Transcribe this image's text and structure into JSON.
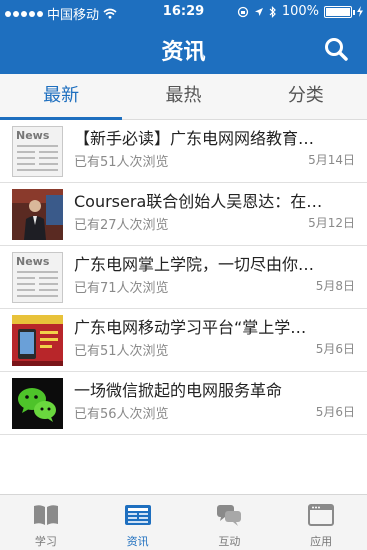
{
  "status_bar": {
    "carrier": "中国移动",
    "time": "16:29",
    "battery": "100%",
    "battery_level": 1.0
  },
  "nav": {
    "title": "资讯",
    "search_icon": "search-icon"
  },
  "tabs": [
    {
      "label": "最新",
      "active": true
    },
    {
      "label": "最热",
      "active": false
    },
    {
      "label": "分类",
      "active": false
    }
  ],
  "news": [
    {
      "title": "【新手必读】广东电网网络教育…",
      "views": "已有51人次浏览",
      "date": "5月14日",
      "thumb": "news-paper"
    },
    {
      "title": "Coursera联合创始人吴恩达：在…",
      "views": "已有27人次浏览",
      "date": "5月12日",
      "thumb": "speaker-photo"
    },
    {
      "title": "广东电网掌上学院，一切尽由你…",
      "views": "已有71人次浏览",
      "date": "5月8日",
      "thumb": "news-paper"
    },
    {
      "title": "广东电网移动学习平台“掌上学…",
      "views": "已有51人次浏览",
      "date": "5月6日",
      "thumb": "platform-banner"
    },
    {
      "title": "一场微信掀起的电网服务革命",
      "views": "已有56人次浏览",
      "date": "5月6日",
      "thumb": "wechat-logo"
    }
  ],
  "news_thumb_label": "News",
  "tabbar": [
    {
      "label": "学习",
      "icon": "book-icon",
      "active": false
    },
    {
      "label": "资讯",
      "icon": "news-icon",
      "active": true
    },
    {
      "label": "互动",
      "icon": "chat-icon",
      "active": false
    },
    {
      "label": "应用",
      "icon": "app-window-icon",
      "active": false
    }
  ],
  "colors": {
    "brand": "#1e6fbf",
    "text": "#222222",
    "muted": "#8a8a8a"
  }
}
